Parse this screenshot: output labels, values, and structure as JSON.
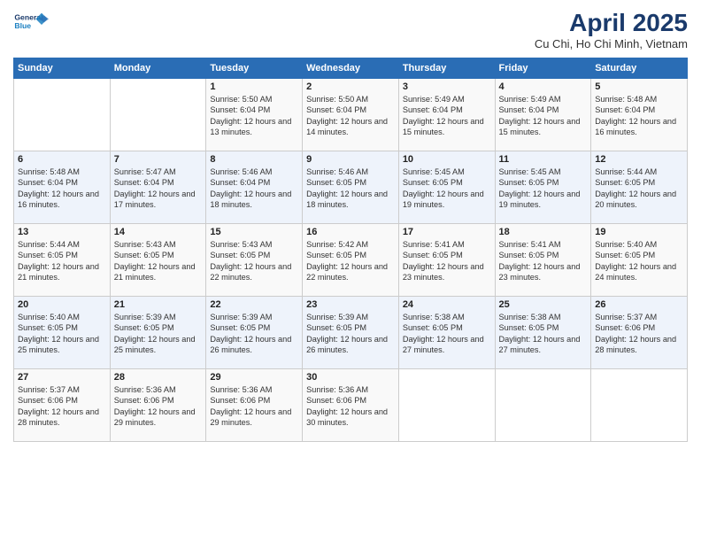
{
  "header": {
    "logo_line1": "General",
    "logo_line2": "Blue",
    "title": "April 2025",
    "subtitle": "Cu Chi, Ho Chi Minh, Vietnam"
  },
  "weekdays": [
    "Sunday",
    "Monday",
    "Tuesday",
    "Wednesday",
    "Thursday",
    "Friday",
    "Saturday"
  ],
  "weeks": [
    [
      {
        "day": "",
        "info": ""
      },
      {
        "day": "",
        "info": ""
      },
      {
        "day": "1",
        "info": "Sunrise: 5:50 AM\nSunset: 6:04 PM\nDaylight: 12 hours and 13 minutes."
      },
      {
        "day": "2",
        "info": "Sunrise: 5:50 AM\nSunset: 6:04 PM\nDaylight: 12 hours and 14 minutes."
      },
      {
        "day": "3",
        "info": "Sunrise: 5:49 AM\nSunset: 6:04 PM\nDaylight: 12 hours and 15 minutes."
      },
      {
        "day": "4",
        "info": "Sunrise: 5:49 AM\nSunset: 6:04 PM\nDaylight: 12 hours and 15 minutes."
      },
      {
        "day": "5",
        "info": "Sunrise: 5:48 AM\nSunset: 6:04 PM\nDaylight: 12 hours and 16 minutes."
      }
    ],
    [
      {
        "day": "6",
        "info": "Sunrise: 5:48 AM\nSunset: 6:04 PM\nDaylight: 12 hours and 16 minutes."
      },
      {
        "day": "7",
        "info": "Sunrise: 5:47 AM\nSunset: 6:04 PM\nDaylight: 12 hours and 17 minutes."
      },
      {
        "day": "8",
        "info": "Sunrise: 5:46 AM\nSunset: 6:04 PM\nDaylight: 12 hours and 18 minutes."
      },
      {
        "day": "9",
        "info": "Sunrise: 5:46 AM\nSunset: 6:05 PM\nDaylight: 12 hours and 18 minutes."
      },
      {
        "day": "10",
        "info": "Sunrise: 5:45 AM\nSunset: 6:05 PM\nDaylight: 12 hours and 19 minutes."
      },
      {
        "day": "11",
        "info": "Sunrise: 5:45 AM\nSunset: 6:05 PM\nDaylight: 12 hours and 19 minutes."
      },
      {
        "day": "12",
        "info": "Sunrise: 5:44 AM\nSunset: 6:05 PM\nDaylight: 12 hours and 20 minutes."
      }
    ],
    [
      {
        "day": "13",
        "info": "Sunrise: 5:44 AM\nSunset: 6:05 PM\nDaylight: 12 hours and 21 minutes."
      },
      {
        "day": "14",
        "info": "Sunrise: 5:43 AM\nSunset: 6:05 PM\nDaylight: 12 hours and 21 minutes."
      },
      {
        "day": "15",
        "info": "Sunrise: 5:43 AM\nSunset: 6:05 PM\nDaylight: 12 hours and 22 minutes."
      },
      {
        "day": "16",
        "info": "Sunrise: 5:42 AM\nSunset: 6:05 PM\nDaylight: 12 hours and 22 minutes."
      },
      {
        "day": "17",
        "info": "Sunrise: 5:41 AM\nSunset: 6:05 PM\nDaylight: 12 hours and 23 minutes."
      },
      {
        "day": "18",
        "info": "Sunrise: 5:41 AM\nSunset: 6:05 PM\nDaylight: 12 hours and 23 minutes."
      },
      {
        "day": "19",
        "info": "Sunrise: 5:40 AM\nSunset: 6:05 PM\nDaylight: 12 hours and 24 minutes."
      }
    ],
    [
      {
        "day": "20",
        "info": "Sunrise: 5:40 AM\nSunset: 6:05 PM\nDaylight: 12 hours and 25 minutes."
      },
      {
        "day": "21",
        "info": "Sunrise: 5:39 AM\nSunset: 6:05 PM\nDaylight: 12 hours and 25 minutes."
      },
      {
        "day": "22",
        "info": "Sunrise: 5:39 AM\nSunset: 6:05 PM\nDaylight: 12 hours and 26 minutes."
      },
      {
        "day": "23",
        "info": "Sunrise: 5:39 AM\nSunset: 6:05 PM\nDaylight: 12 hours and 26 minutes."
      },
      {
        "day": "24",
        "info": "Sunrise: 5:38 AM\nSunset: 6:05 PM\nDaylight: 12 hours and 27 minutes."
      },
      {
        "day": "25",
        "info": "Sunrise: 5:38 AM\nSunset: 6:05 PM\nDaylight: 12 hours and 27 minutes."
      },
      {
        "day": "26",
        "info": "Sunrise: 5:37 AM\nSunset: 6:06 PM\nDaylight: 12 hours and 28 minutes."
      }
    ],
    [
      {
        "day": "27",
        "info": "Sunrise: 5:37 AM\nSunset: 6:06 PM\nDaylight: 12 hours and 28 minutes."
      },
      {
        "day": "28",
        "info": "Sunrise: 5:36 AM\nSunset: 6:06 PM\nDaylight: 12 hours and 29 minutes."
      },
      {
        "day": "29",
        "info": "Sunrise: 5:36 AM\nSunset: 6:06 PM\nDaylight: 12 hours and 29 minutes."
      },
      {
        "day": "30",
        "info": "Sunrise: 5:36 AM\nSunset: 6:06 PM\nDaylight: 12 hours and 30 minutes."
      },
      {
        "day": "",
        "info": ""
      },
      {
        "day": "",
        "info": ""
      },
      {
        "day": "",
        "info": ""
      }
    ]
  ]
}
